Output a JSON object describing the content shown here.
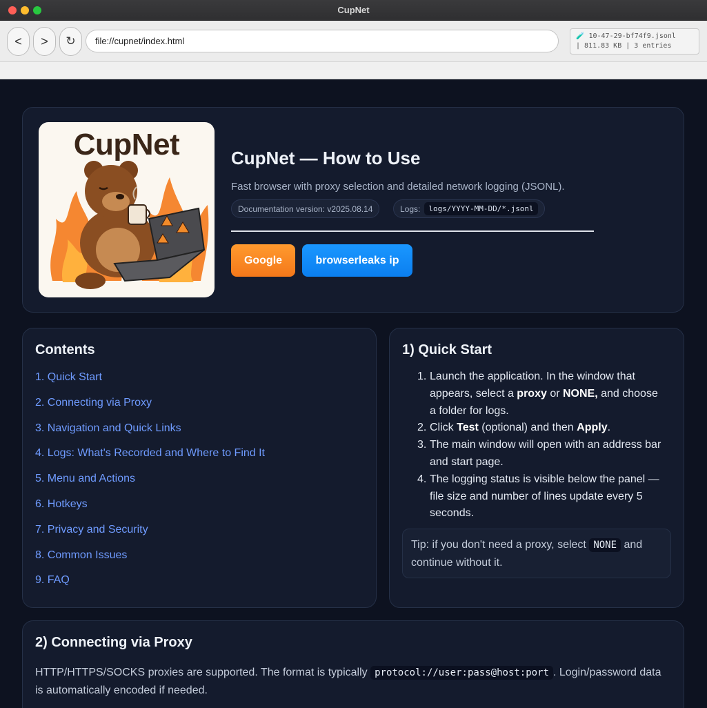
{
  "window": {
    "title": "CupNet"
  },
  "toolbar": {
    "back_label": "<",
    "forward_label": ">",
    "reload_label": "↻",
    "url": "file://cupnet/index.html",
    "log_file": "🧪 10-47-29-bf74f9.jsonl",
    "log_meta": "| 811.83 KB | 3 entries"
  },
  "hero": {
    "logo_text": "CupNet",
    "title": "CupNet — How to Use",
    "subtitle": "Fast browser with proxy selection and detailed network logging (JSONL).",
    "doc_version": "Documentation version: v2025.08.14",
    "logs_label": "Logs:",
    "logs_path": "logs/YYYY-MM-DD/*.jsonl",
    "btn_google": "Google",
    "btn_browserleaks": "browserleaks ip"
  },
  "contents": {
    "heading": "Contents",
    "items": [
      "1. Quick Start",
      "2. Connecting via Proxy",
      "3. Navigation and Quick Links",
      "4. Logs: What's Recorded and Where to Find It",
      "5. Menu and Actions",
      "6. Hotkeys",
      "7. Privacy and Security",
      "8. Common Issues",
      "9. FAQ"
    ]
  },
  "quick_start": {
    "heading": "1) Quick Start",
    "step1_a": "Launch the application. In the window that appears, select a ",
    "step1_b": "proxy",
    "step1_c": " or ",
    "step1_d": "NONE,",
    "step1_e": " and choose a folder for logs.",
    "step2_a": "Click ",
    "step2_b": "Test",
    "step2_c": " (optional) and then ",
    "step2_d": "Apply",
    "step2_e": ".",
    "step3": "The main window will open with an address bar and start page.",
    "step4": "The logging status is visible below the panel — file size and number of lines update every 5 seconds.",
    "tip_a": "Tip: if you don't need a proxy, select ",
    "tip_code": "NONE",
    "tip_b": " and continue without it."
  },
  "proxy": {
    "heading": "2) Connecting via Proxy",
    "text_a": "HTTP/HTTPS/SOCKS proxies are supported. The format is typically ",
    "text_code": "protocol://user:pass@host:port",
    "text_b": ". Login/password data is automatically encoded if needed."
  }
}
